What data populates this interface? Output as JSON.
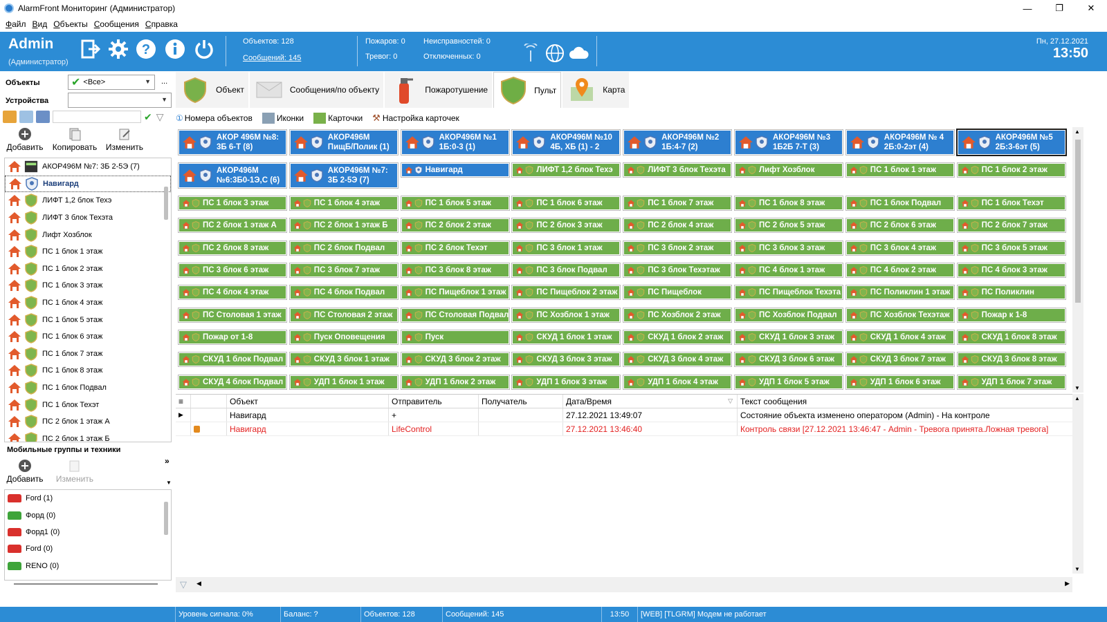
{
  "window": {
    "title": "AlarmFront Мониторинг (Администратор)"
  },
  "menu": [
    "Файл",
    "Вид",
    "Объекты",
    "Сообщения",
    "Справка"
  ],
  "header": {
    "user": "Admin",
    "role": "(Администратор)",
    "objects": "Объектов: 128",
    "messages": "Сообщений: 145",
    "fires": "Пожаров: 0",
    "alarms": "Тревог: 0",
    "faults": "Неисправностей: 0",
    "disabled": "Отключенных: 0",
    "date": "Пн, 27.12.2021",
    "time": "13:50"
  },
  "left": {
    "objects_label": "Объекты",
    "objects_value": "<Все>",
    "devices_label": "Устройства",
    "devices_value": "",
    "more": "...",
    "add": "Добавить",
    "copy": "Копировать",
    "edit": "Изменить",
    "tree": [
      "АКОР496М №7: 3Б 2-5Э (7)",
      "Навигард",
      "ЛИФТ 1,2 блок Техэ",
      "ЛИФТ 3 блок Техэта",
      "Лифт Хозблок",
      "ПС 1 блок 1 этаж",
      "ПС 1 блок 2 этаж",
      "ПС 1 блок 3 этаж",
      "ПС 1 блок 4 этаж",
      "ПС 1 блок 5 этаж",
      "ПС 1 блок 6 этаж",
      "ПС 1 блок 7 этаж",
      "ПС 1 блок 8 этаж",
      "ПС 1 блок Подвал",
      "ПС 1 блок Техэт",
      "ПС 2 блок 1 этаж А",
      "ПС 2 блок 1 этаж Б"
    ],
    "mobile_title": "Мобильные группы и техники",
    "mobile_add": "Добавить",
    "mobile_edit": "Изменить",
    "mobile": [
      {
        "name": "Ford (1)",
        "color": "#d9302c"
      },
      {
        "name": "Форд (0)",
        "color": "#3ea43a"
      },
      {
        "name": "Форд1 (0)",
        "color": "#d9302c"
      },
      {
        "name": "Ford (0)",
        "color": "#d9302c"
      },
      {
        "name": "RENO (0)",
        "color": "#3ea43a"
      }
    ]
  },
  "tabs": [
    "Объект",
    "Сообщения/по объекту",
    "Пожаротушение",
    "Пульт",
    "Карта"
  ],
  "subtabs": [
    "Номера объектов",
    "Иконки",
    "Карточки",
    "Настройка карточек"
  ],
  "cards_blue": [
    "АКОР 496М №8: 3Б 6-Т (8)",
    "АКОР496М ПищБ/Полик (1)",
    "АКОР496М №1 1Б:0-3 (1)",
    "АКОР496М №10 4Б, ХБ (1) - 2",
    "АКОР496М №2 1Б:4-7 (2)",
    "АКОР496М №3 1Б2Б 7-Т (3)",
    "АКОР496М № 4 2Б:0-2эт (4)",
    "АКОР496М №5 2Б:3-6эт (5)",
    "АКОР496М №6:3Б0-1Э,С (6)",
    "АКОР496М №7: 3Б 2-5Э (7)",
    "Навигард"
  ],
  "cards_green": [
    "ЛИФТ 1,2 блок Техэ",
    "ЛИФТ 3 блок Техэта",
    "Лифт Хозблок",
    "ПС 1 блок 1 этаж",
    "ПС 1 блок 2 этаж",
    "ПС 1 блок 3 этаж",
    "ПС 1 блок 4 этаж",
    "ПС 1 блок 5 этаж",
    "ПС 1 блок 6 этаж",
    "ПС 1 блок 7 этаж",
    "ПС 1 блок 8 этаж",
    "ПС 1 блок Подвал",
    "ПС 1 блок Техэт",
    "ПС 2 блок 1 этаж А",
    "ПС 2 блок 1 этаж Б",
    "ПС 2 блок 2 этаж",
    "ПС 2 блок 3 этаж",
    "ПС 2 блок 4 этаж",
    "ПС 2 блок 5 этаж",
    "ПС 2 блок 6 этаж",
    "ПС 2 блок 7 этаж",
    "ПС 2 блок 8 этаж",
    "ПС 2 блок Подвал",
    "ПС 2 блок Техэт",
    "ПС 3 блок 1 этаж",
    "ПС 3 блок 2 этаж",
    "ПС 3 блок 3 этаж",
    "ПС 3 блок 4 этаж",
    "ПС 3 блок 5 этаж",
    "ПС 3 блок 6 этаж",
    "ПС 3 блок 7 этаж",
    "ПС 3 блок 8 этаж",
    "ПС 3 блок Подвал",
    "ПС 3 блок Техэтаж",
    "ПС 4 блок 1 этаж",
    "ПС 4 блок 2 этаж",
    "ПС 4 блок 3 этаж",
    "ПС 4 блок 4 этаж",
    "ПС 4 блок Подвал",
    "ПС Пищеблок 1 этаж",
    "ПС Пищеблок 2 этаж",
    "ПС Пищеблок",
    "ПС Пищеблок Техэта",
    "ПС Поликлин 1 этаж",
    "ПС Поликлин",
    "ПС Столовая 1 этаж",
    "ПС Столовая 2 этаж",
    "ПС Столовая Подвал",
    "ПС Хозблок 1 этаж",
    "ПС Хозблок 2 этаж",
    "ПС Хозблок Подвал",
    "ПС Хозблок Техэтаж",
    "Пожар к 1-8",
    "Пожар от 1-8",
    "Пуск Оповещения",
    "Пуск",
    "СКУД 1 блок 1 этаж",
    "СКУД 1 блок 2 этаж",
    "СКУД 1 блок 3 этаж",
    "СКУД 1 блок 4 этаж",
    "СКУД 1 блок 8 этаж",
    "СКУД 1 блок Подвал",
    "СКУД 3 блок 1 этаж",
    "СКУД 3 блок 2 этаж",
    "СКУД 3 блок 3 этаж",
    "СКУД 3 блок 4 этаж",
    "СКУД 3 блок 6 этаж",
    "СКУД 3 блок 7 этаж",
    "СКУД 3 блок 8 этаж",
    "СКУД 4 блок Подвал",
    "УДП 1 блок 1 этаж",
    "УДП 1 блок 2 этаж",
    "УДП 1 блок 3 этаж",
    "УДП 1 блок 4 этаж",
    "УДП 1 блок 5 этаж",
    "УДП 1 блок 6 этаж",
    "УДП 1 блок 7 этаж"
  ],
  "log": {
    "columns": [
      "Объект",
      "Отправитель",
      "Получатель",
      "Дата/Время",
      "Текст сообщения"
    ],
    "rows": [
      {
        "object": "Навигард",
        "sender": "+",
        "receiver": "",
        "datetime": "27.12.2021 13:49:07",
        "text": "Состояние объекта изменено оператором (Admin) - На контроле",
        "red": false
      },
      {
        "object": "Навигард",
        "sender": "LifeControl",
        "receiver": "",
        "datetime": "27.12.2021 13:46:40",
        "text": "Контроль связи [27.12.2021 13:46:47 - Admin - Тревога принята.Ложная тревога]",
        "red": true
      }
    ]
  },
  "status": {
    "signal": "Уровень сигнала: 0%",
    "balance": "Баланс: ?",
    "objects": "Объектов: 128",
    "messages": "Сообщений: 145",
    "time": "13:50",
    "modem": "[WEB] [TLGRM] Модем не работает"
  },
  "colors": {
    "header": "#2c8cd5",
    "card_blue": "#2d7fd0",
    "card_green": "#6eae4a",
    "alarm_red": "#e32020"
  }
}
